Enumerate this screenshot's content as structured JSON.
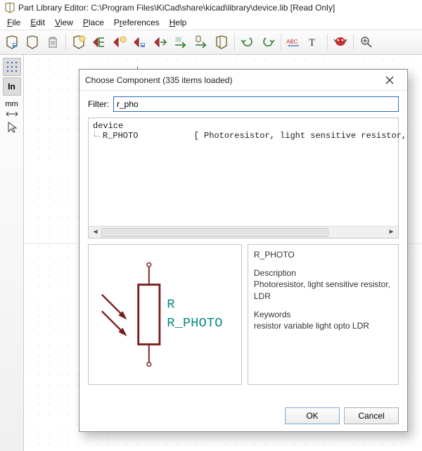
{
  "window": {
    "title": "Part Library Editor: C:\\Program Files\\KiCad\\share\\kicad\\library\\device.lib [Read Only]"
  },
  "menu": {
    "file": "File",
    "edit": "Edit",
    "view": "View",
    "place": "Place",
    "preferences": "Preferences",
    "help": "Help"
  },
  "sidebar": {
    "in_label": "In",
    "mm_label": "mm"
  },
  "dialog": {
    "title": "Choose Component (335 items loaded)",
    "filter_label": "Filter:",
    "filter_value": "r_pho",
    "tree": {
      "lib_name": "device",
      "item_name": "R_PHOTO",
      "item_desc": "[ Photoresistor, light sensitive resistor, LDR ]"
    },
    "preview": {
      "ref_text": "R",
      "name_text": "R_PHOTO"
    },
    "details": {
      "name": "R_PHOTO",
      "desc_hdr": "Description",
      "desc_body": "Photoresistor, light sensitive resistor, LDR",
      "kw_hdr": "Keywords",
      "kw_body": "resistor variable light opto LDR"
    },
    "ok_label": "OK",
    "cancel_label": "Cancel"
  }
}
